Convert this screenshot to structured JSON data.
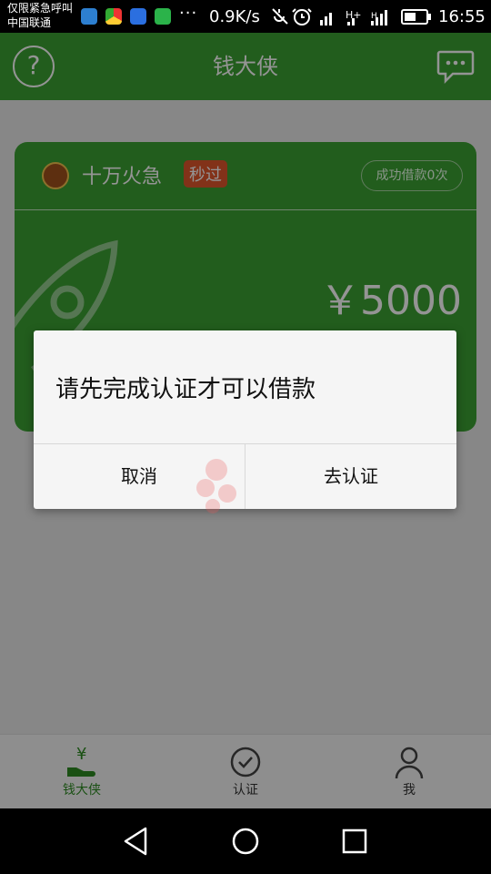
{
  "status_bar": {
    "carrier_line1": "仅限紧急呼叫",
    "carrier_line2": "中国联通",
    "net_speed": "0.9K/s",
    "time": "16:55",
    "dots": "···"
  },
  "header": {
    "title": "钱大侠",
    "help_icon": "?"
  },
  "loan_card": {
    "name": "十万火急",
    "badge": "秒过",
    "success_count": "成功借款0次",
    "amount": "￥5000"
  },
  "dialog": {
    "message": "请先完成认证才可以借款",
    "cancel_label": "取消",
    "confirm_label": "去认证"
  },
  "bottom_nav": {
    "items": [
      {
        "label": "钱大侠",
        "icon": "money-hand-icon",
        "active": true
      },
      {
        "label": "认证",
        "icon": "check-circle-icon",
        "active": false
      },
      {
        "label": "我",
        "icon": "person-icon",
        "active": false
      }
    ]
  },
  "colors": {
    "brand_green": "#3ca133",
    "badge_orange": "#e0562c"
  }
}
